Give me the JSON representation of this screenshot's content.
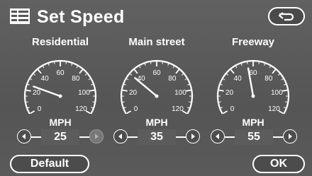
{
  "header": {
    "title": "Set Speed",
    "back_icon": "return-arrow-icon",
    "title_icon": "speed-settings-icon"
  },
  "gauges": [
    {
      "label": "Residential",
      "unit": "MPH",
      "ticks": [
        "0",
        "20",
        "40",
        "60",
        "80",
        "100",
        "120"
      ],
      "value": 25,
      "display_value": "25",
      "decrease_enabled": true,
      "increase_enabled": false
    },
    {
      "label": "Main street",
      "unit": "MPH",
      "ticks": [
        "0",
        "20",
        "40",
        "60",
        "80",
        "100",
        "120"
      ],
      "value": 35,
      "display_value": "35",
      "decrease_enabled": true,
      "increase_enabled": true
    },
    {
      "label": "Freeway",
      "unit": "MPH",
      "ticks": [
        "0",
        "20",
        "40",
        "60",
        "80",
        "100",
        "120"
      ],
      "value": 55,
      "display_value": "55",
      "decrease_enabled": true,
      "increase_enabled": true
    }
  ],
  "footer": {
    "default_label": "Default",
    "ok_label": "OK"
  },
  "colors": {
    "background": "#5b5b5b",
    "foreground": "#ffffff"
  }
}
